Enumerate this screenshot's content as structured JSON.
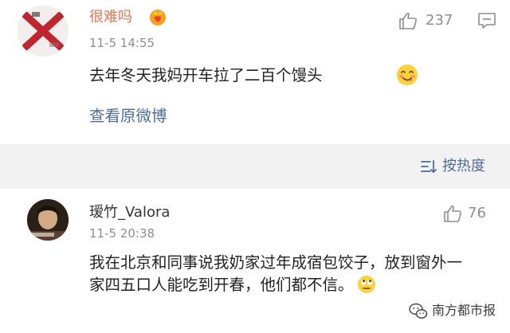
{
  "comments": [
    {
      "username": "很难吗",
      "username_color": "#eb7350",
      "badge_icon": "crown-heart-icon",
      "time": "11-5 14:55",
      "likes": "237",
      "text": "去年冬天我妈开车拉了二百个馒头",
      "emoji": "yummy-face-emoji",
      "link_label": "查看原微博"
    },
    {
      "username": "瑷竹_Valora",
      "username_color": "#333333",
      "time": "11-5 20:38",
      "likes": "76",
      "text": "我在北京和同事说我奶家过年成宿包饺子，放到窗外一家四五口人能吃到开春，他们都不信。",
      "emoji": "eye-roll-emoji"
    }
  ],
  "sort": {
    "label": "按热度",
    "icon": "sort-icon"
  },
  "watermark": {
    "text": "南方都市报",
    "icon": "wechat-icon"
  },
  "colors": {
    "link": "#506b9a",
    "secondary": "#8e8e8e",
    "sort_bar_bg": "#f2f2f2"
  }
}
